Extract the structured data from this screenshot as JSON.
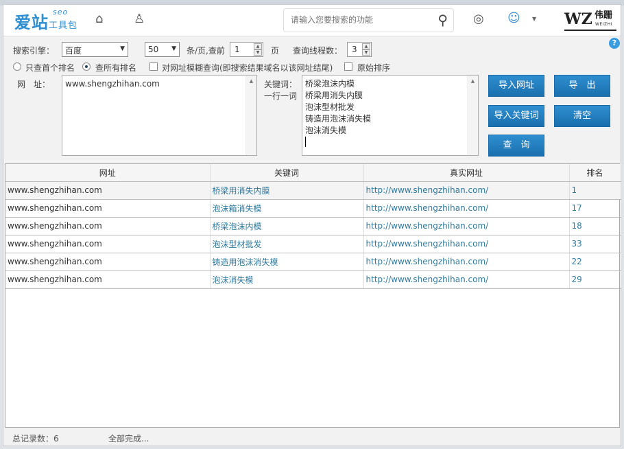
{
  "app": {
    "logo_main": "爱站",
    "logo_sub": "工具包",
    "logo_seo": "seo",
    "brand": "WZ",
    "brand_cn": "伟跚",
    "brand_en": "WEIZHI"
  },
  "header": {
    "search_placeholder": "请输入您要搜索的功能"
  },
  "controls": {
    "engine_label": "搜索引擎：",
    "engine_value": "百度",
    "per_page_value": "50",
    "per_page_label": "条/页,查前",
    "pages_value": "1",
    "pages_label": "页",
    "threads_label": "查询线程数：",
    "threads_value": "3",
    "radio_first": "只查首个排名",
    "radio_all": "查所有排名",
    "fuzzy_label": "对网址模糊查询(即搜索结果域名以该网址结尾)",
    "raw_sort_label": "原始排序",
    "url_label": "网　址：",
    "url_value": "www.shengzhihan.com",
    "kw_label": "关键词：",
    "kw_hint": "一行一词",
    "keywords": [
      "桥梁泡沫内模",
      "桥梁用消失内膜",
      "泡沫型材批发",
      "铸造用泡沫消失模",
      "泡沫消失模"
    ],
    "buttons": {
      "import_url": "导入网址",
      "export": "导　出",
      "import_kw": "导入关键词",
      "clear": "清空",
      "query": "查　询"
    }
  },
  "table": {
    "headers": [
      "网址",
      "关键词",
      "真实网址",
      "排名"
    ],
    "rows": [
      [
        "www.shengzhihan.com",
        "桥梁用消失内膜",
        "http://www.shengzhihan.com/",
        "1"
      ],
      [
        "www.shengzhihan.com",
        "泡沫箱消失模",
        "http://www.shengzhihan.com/",
        "17"
      ],
      [
        "www.shengzhihan.com",
        "桥梁泡沫内模",
        "http://www.shengzhihan.com/",
        "18"
      ],
      [
        "www.shengzhihan.com",
        "泡沫型材批发",
        "http://www.shengzhihan.com/",
        "33"
      ],
      [
        "www.shengzhihan.com",
        "铸造用泡沫消失模",
        "http://www.shengzhihan.com/",
        "22"
      ],
      [
        "www.shengzhihan.com",
        "泡沫消失模",
        "http://www.shengzhihan.com/",
        "29"
      ]
    ]
  },
  "status": {
    "total": "总记录数：6",
    "state": "全部完成..."
  }
}
